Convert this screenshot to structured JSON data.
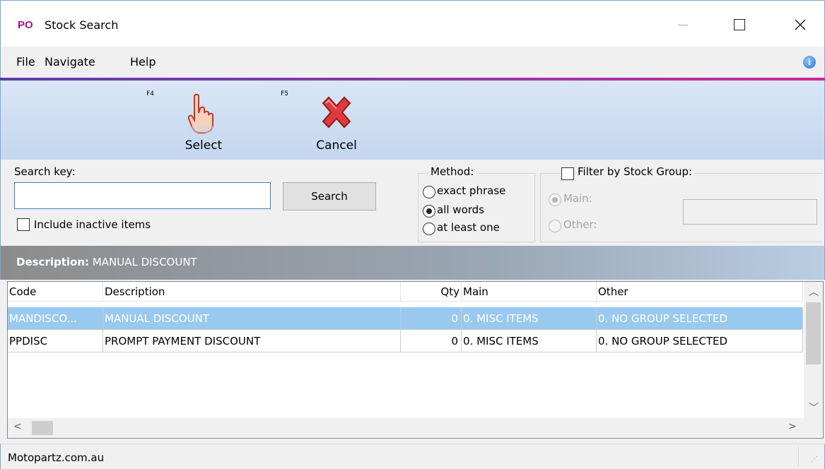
{
  "window": {
    "app_badge": "PO",
    "title": "Stock Search",
    "minimize_glyph": "—",
    "close_glyph": "✕"
  },
  "menu": {
    "items": [
      "File",
      "Navigate",
      "Help"
    ]
  },
  "toolbar": {
    "select": {
      "key": "F4",
      "label": "Select",
      "icon": "hand-pointer-icon"
    },
    "cancel": {
      "key": "F5",
      "label": "Cancel",
      "icon": "red-x-icon"
    }
  },
  "search": {
    "key_label": "Search key:",
    "value": "",
    "button_label": "Search",
    "include_inactive_label": "Include inactive items",
    "include_inactive_checked": false
  },
  "method": {
    "title": "Method:",
    "options": [
      "exact phrase",
      "all words",
      "at least one"
    ],
    "selected": "all words"
  },
  "filter": {
    "label": "Filter by Stock Group:",
    "checked": false,
    "main_label": "Main:",
    "other_label": "Other:",
    "selected": "Main"
  },
  "description_bar": {
    "key": "Description:",
    "value": "MANUAL DISCOUNT"
  },
  "grid": {
    "columns": [
      "Code",
      "Description",
      "Qty",
      "Main",
      "Other"
    ],
    "rows": [
      {
        "code": "MANDISCO...",
        "description": "MANUAL DISCOUNT",
        "qty": "0",
        "main": "0. MISC ITEMS",
        "other": "0. NO GROUP SELECTED",
        "selected": true
      },
      {
        "code": "PPDISC",
        "description": "PROMPT PAYMENT DISCOUNT",
        "qty": "0",
        "main": "0. MISC ITEMS",
        "other": "0. NO GROUP SELECTED",
        "selected": false
      }
    ]
  },
  "status": {
    "text": "Motopartz.com.au"
  },
  "colors": {
    "selection": "#99c9ef",
    "badge": "#9c1a8c",
    "accent_start": "#5a3ea8",
    "accent_end": "#d0279b"
  }
}
